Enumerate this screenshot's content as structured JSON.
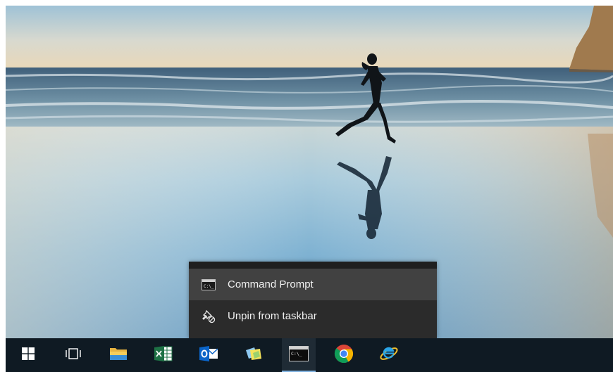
{
  "context_menu": {
    "items": [
      {
        "label": "Command Prompt",
        "icon": "command-prompt-icon"
      },
      {
        "label": "Unpin from taskbar",
        "icon": "unpin-icon"
      }
    ]
  },
  "taskbar": {
    "buttons": [
      {
        "name": "start-button",
        "icon": "windows-logo-icon"
      },
      {
        "name": "task-view-button",
        "icon": "task-view-icon"
      },
      {
        "name": "file-explorer-button",
        "icon": "folder-icon"
      },
      {
        "name": "excel-button",
        "icon": "excel-icon"
      },
      {
        "name": "outlook-button",
        "icon": "outlook-icon"
      },
      {
        "name": "sticky-notes-button",
        "icon": "sticky-notes-icon"
      },
      {
        "name": "command-prompt-button",
        "icon": "command-prompt-icon",
        "active": true
      },
      {
        "name": "chrome-button",
        "icon": "chrome-icon"
      },
      {
        "name": "internet-explorer-button",
        "icon": "internet-explorer-icon"
      }
    ]
  },
  "colors": {
    "taskbar_bg": "#0f1a23",
    "menu_bg": "#2b2b2b",
    "menu_hover": "#414141",
    "active_indicator": "#7fb2e0"
  }
}
